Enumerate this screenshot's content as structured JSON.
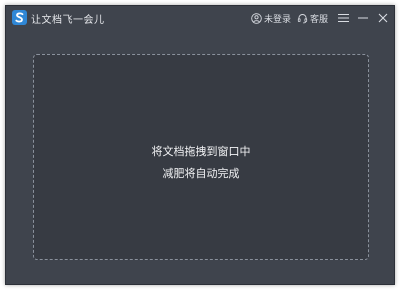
{
  "app": {
    "title": "让文档飞一会儿",
    "accent_color": "#2f87d6",
    "background_color": "#3f444d"
  },
  "titlebar": {
    "login_label": "未登录",
    "support_label": "客服",
    "icons": [
      "user-icon",
      "headset-icon",
      "menu-icon",
      "minimize-icon",
      "close-icon"
    ]
  },
  "drop_zone": {
    "line1": "将文档拖拽到窗口中",
    "line2": "减肥将自动完成"
  }
}
